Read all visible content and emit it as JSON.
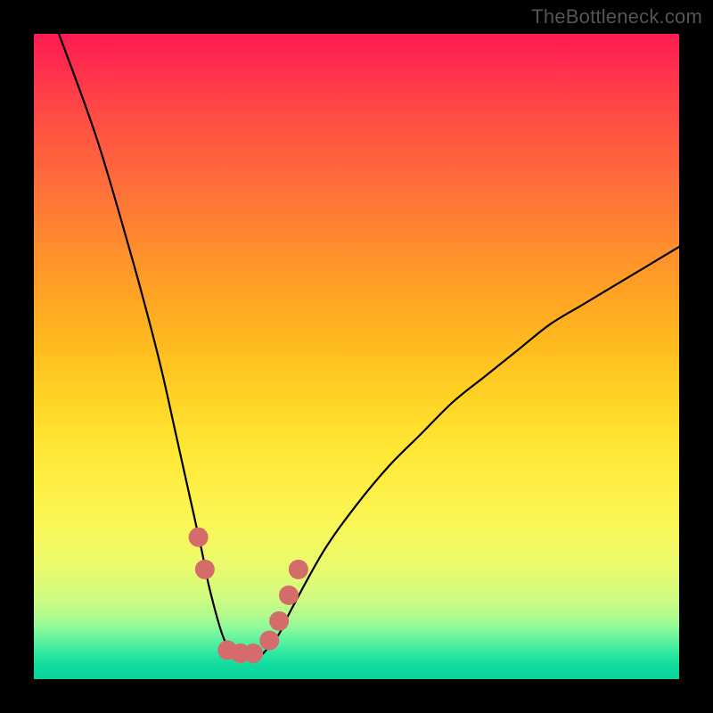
{
  "watermark": "TheBottleneck.com",
  "colors": {
    "background": "#000000",
    "curve": "#000000",
    "marker": "#d56c6c",
    "marker_stroke": "#b65656"
  },
  "chart_data": {
    "type": "line",
    "title": "",
    "xlabel": "",
    "ylabel": "",
    "xlim": [
      0,
      100
    ],
    "ylim": [
      0,
      100
    ],
    "series": [
      {
        "name": "bottleneck-curve",
        "x": [
          0,
          5,
          10,
          15,
          18,
          20,
          22,
          24,
          26,
          27,
          28,
          29,
          30,
          31,
          32,
          33,
          34,
          35,
          36,
          38,
          40,
          45,
          50,
          55,
          60,
          65,
          70,
          75,
          80,
          85,
          90,
          95,
          100
        ],
        "y": [
          110,
          97,
          83,
          66,
          55,
          47,
          38,
          29,
          20,
          15,
          11,
          7.5,
          5,
          3.5,
          3,
          3,
          3,
          3.5,
          4.5,
          7,
          11,
          20,
          27,
          33,
          38,
          43,
          47,
          51,
          55,
          58,
          61,
          64,
          67
        ]
      }
    ],
    "markers": [
      {
        "x": 25.5,
        "y": 22
      },
      {
        "x": 26.5,
        "y": 17
      },
      {
        "x": 30,
        "y": 4.5
      },
      {
        "x": 32,
        "y": 4
      },
      {
        "x": 34,
        "y": 4
      },
      {
        "x": 36.5,
        "y": 6
      },
      {
        "x": 38,
        "y": 9
      },
      {
        "x": 39.5,
        "y": 13
      },
      {
        "x": 41,
        "y": 17
      }
    ]
  }
}
